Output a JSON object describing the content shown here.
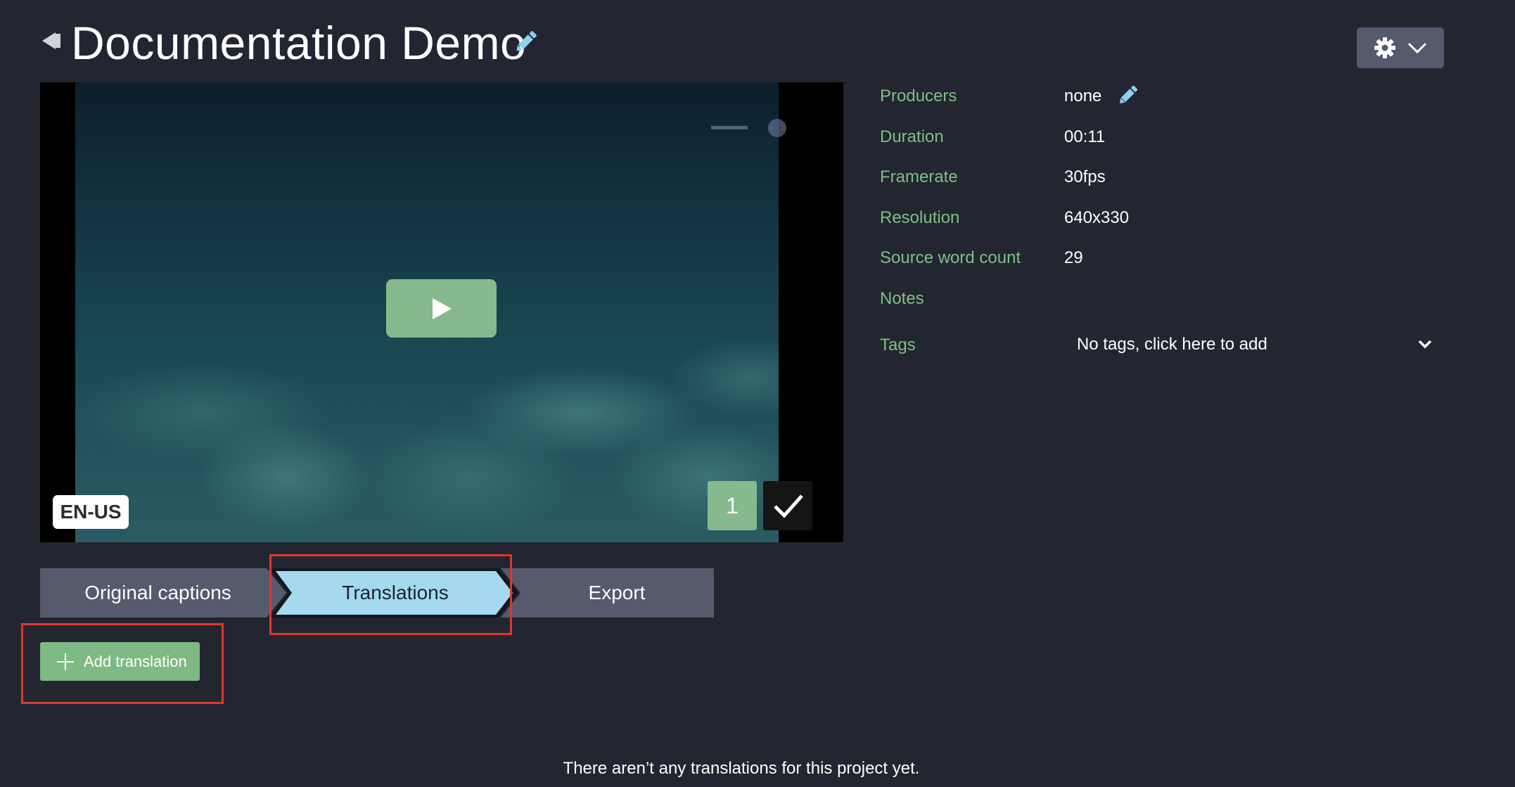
{
  "header": {
    "title": "Documentation Demo"
  },
  "video": {
    "language_badge": "EN-US",
    "caption_count": "1"
  },
  "metadata": {
    "rows": [
      {
        "label": "Producers",
        "value": "none"
      },
      {
        "label": "Duration",
        "value": "00:11"
      },
      {
        "label": "Framerate",
        "value": "30fps"
      },
      {
        "label": "Resolution",
        "value": "640x330"
      },
      {
        "label": "Source word count",
        "value": "29"
      },
      {
        "label": "Notes",
        "value": ""
      }
    ],
    "tags_label": "Tags",
    "tags_placeholder": "No tags, click here to add"
  },
  "tabs": [
    {
      "label": "Original captions",
      "active": false
    },
    {
      "label": "Translations",
      "active": true
    },
    {
      "label": "Export",
      "active": false
    }
  ],
  "actions": {
    "add_translation": "Add translation"
  },
  "empty_message": "There aren’t any translations for this project yet.",
  "colors": {
    "background": "#232630",
    "accent_green": "#86b98b",
    "label_green": "#7fbf86",
    "tab_active": "#a4d9f0",
    "tab_inactive": "#555a6c",
    "edit_icon_blue": "#8fd0f0",
    "annotation_red": "#e0362c"
  },
  "icons": {
    "back": "back-arrow-icon",
    "edit": "pencil-icon",
    "settings": "gear-icon",
    "dropdown": "chevron-down-icon",
    "play": "play-icon",
    "check": "checkmark-icon",
    "add": "plus-icon"
  }
}
